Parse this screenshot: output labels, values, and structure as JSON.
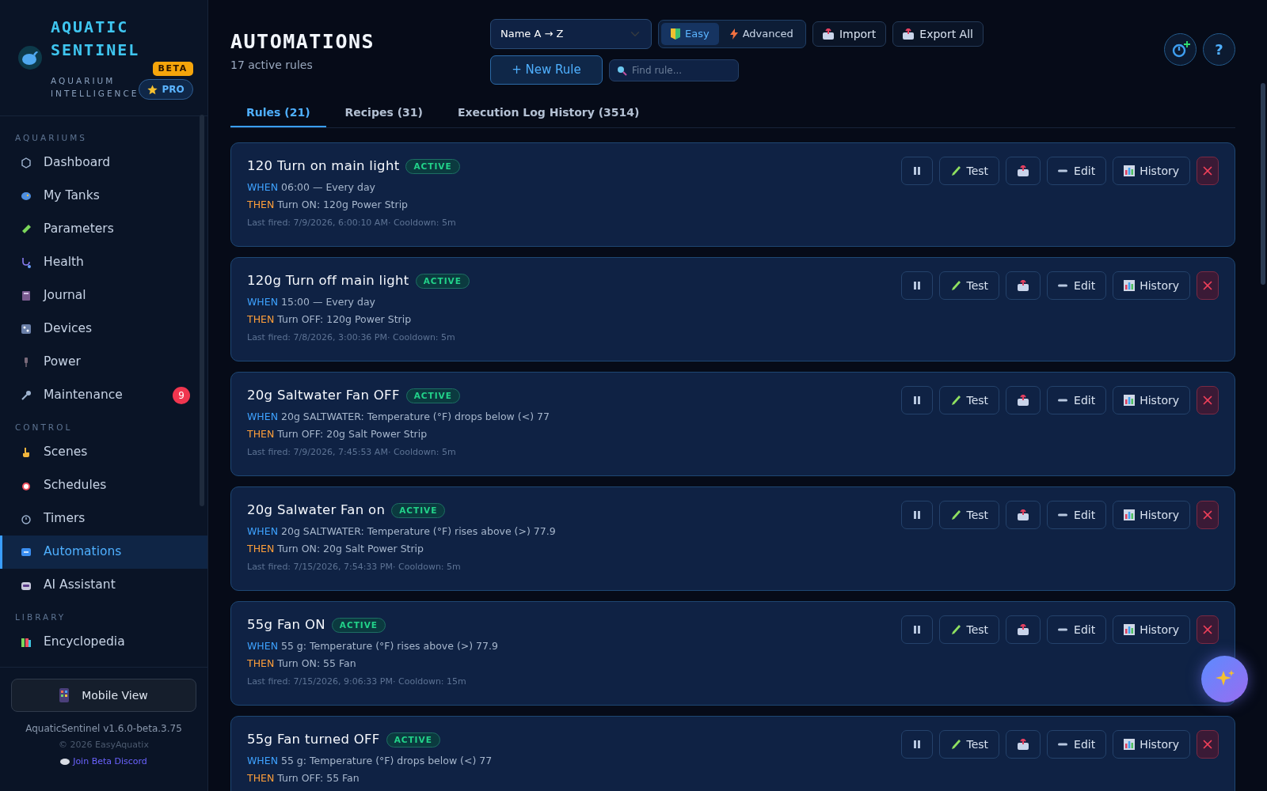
{
  "brand": {
    "title": "AQUATIC SENTINEL",
    "subtitle": "AQUARIUM INTELLIGENCE",
    "beta": "BETA",
    "plan": "PRO"
  },
  "sidebar": {
    "sections": [
      {
        "title": "AQUARIUMS",
        "items": [
          {
            "label": "Dashboard",
            "selected": false
          },
          {
            "label": "My Tanks",
            "selected": false
          },
          {
            "label": "Parameters",
            "selected": false
          },
          {
            "label": "Health",
            "selected": false
          },
          {
            "label": "Journal",
            "selected": false
          },
          {
            "label": "Devices",
            "selected": false
          },
          {
            "label": "Power",
            "selected": false
          },
          {
            "label": "Maintenance",
            "selected": false,
            "badge": "9"
          }
        ]
      },
      {
        "title": "CONTROL",
        "items": [
          {
            "label": "Scenes",
            "selected": false
          },
          {
            "label": "Schedules",
            "selected": false
          },
          {
            "label": "Timers",
            "selected": false
          },
          {
            "label": "Automations",
            "selected": true
          },
          {
            "label": "AI Assistant",
            "selected": false
          }
        ]
      },
      {
        "title": "LIBRARY",
        "items": [
          {
            "label": "Encyclopedia",
            "selected": false
          }
        ]
      }
    ],
    "mobile_button": "Mobile View",
    "version": "AquaticSentinel v1.6.0-beta.3.75",
    "copyright": "© 2026 EasyAquatix",
    "discord_link": "Join Beta Discord"
  },
  "header": {
    "title": "AUTOMATIONS",
    "subtitle": "17 active rules",
    "sort": "Name A → Z",
    "modes": [
      {
        "label": "Easy",
        "selected": true
      },
      {
        "label": "Advanced",
        "selected": false
      }
    ],
    "import_button": "Import",
    "export_button": "Export All",
    "new_button": "+ New Rule",
    "search": {
      "placeholder": "Find rule..."
    },
    "help_button": "?"
  },
  "tabs": [
    {
      "label": "Rules (21)",
      "selected": true
    },
    {
      "label": "Recipes (31)",
      "selected": false
    },
    {
      "label": "Execution Log History (3514)",
      "selected": false
    }
  ],
  "rules": [
    {
      "title": "120 Turn on main light",
      "status": "ACTIVE",
      "when_label": "WHEN",
      "when": "06:00 — Every day",
      "then_label": "THEN",
      "then": "Turn ON: 120g Power Strip",
      "last_fired": "Last fired: 7/9/2026, 6:00:10 AM· Cooldown: 5m",
      "test": "Test",
      "edit": "Edit",
      "history": "History"
    },
    {
      "title": "120g Turn off main light",
      "status": "ACTIVE",
      "when_label": "WHEN",
      "when": "15:00 — Every day",
      "then_label": "THEN",
      "then": "Turn OFF: 120g Power Strip",
      "last_fired": "Last fired: 7/8/2026, 3:00:36 PM· Cooldown: 5m",
      "test": "Test",
      "edit": "Edit",
      "history": "History"
    },
    {
      "title": "20g Saltwater Fan OFF",
      "status": "ACTIVE",
      "when_label": "WHEN",
      "when": "20g SALTWATER: Temperature (°F) drops below (<) 77",
      "then_label": "THEN",
      "then": "Turn OFF: 20g Salt Power Strip",
      "last_fired": "Last fired: 7/9/2026, 7:45:53 AM· Cooldown: 5m",
      "test": "Test",
      "edit": "Edit",
      "history": "History"
    },
    {
      "title": "20g Salwater Fan on",
      "status": "ACTIVE",
      "when_label": "WHEN",
      "when": "20g SALTWATER: Temperature (°F) rises above (>) 77.9",
      "then_label": "THEN",
      "then": "Turn ON: 20g Salt Power Strip",
      "last_fired": "Last fired: 7/15/2026, 7:54:33 PM· Cooldown: 5m",
      "test": "Test",
      "edit": "Edit",
      "history": "History"
    },
    {
      "title": "55g Fan ON",
      "status": "ACTIVE",
      "when_label": "WHEN",
      "when": "55 g: Temperature (°F) rises above (>) 77.9",
      "then_label": "THEN",
      "then": "Turn ON: 55 Fan",
      "last_fired": "Last fired: 7/15/2026, 9:06:33 PM· Cooldown: 15m",
      "test": "Test",
      "edit": "Edit",
      "history": "History"
    },
    {
      "title": "55g Fan turned OFF",
      "status": "ACTIVE",
      "when_label": "WHEN",
      "when": "55 g: Temperature (°F) drops below (<) 77",
      "then_label": "THEN",
      "then": "Turn OFF: 55 Fan",
      "test": "Test",
      "edit": "Edit",
      "history": "History"
    }
  ]
}
